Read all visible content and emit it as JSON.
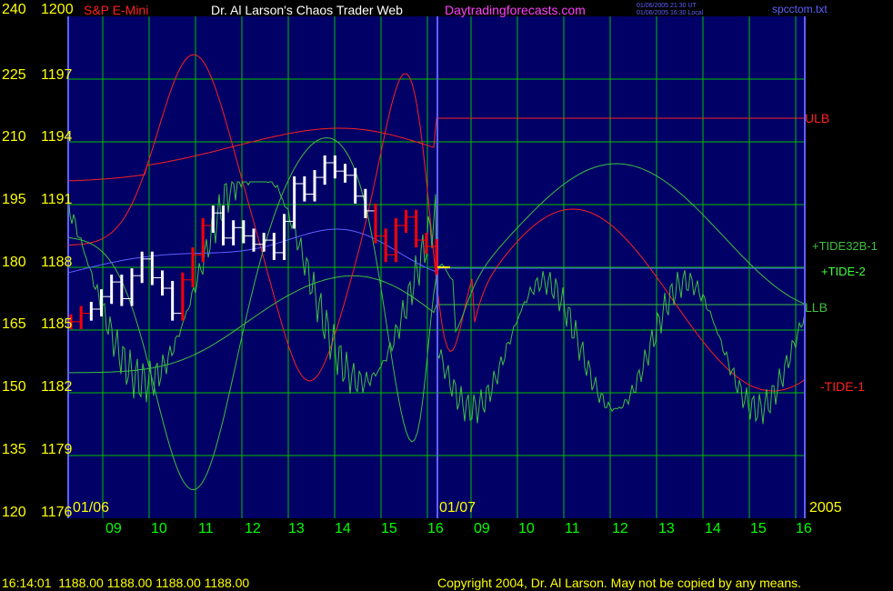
{
  "header": {
    "instrument": "S&P E-Mini",
    "site_title": "Dr. Al Larson's Chaos Trader Web",
    "site_url": "Daytradingforecasts.com",
    "ut_stamp": "01/06/2005 21:30 UT",
    "local_stamp": "01/06/2005 16:30 Local",
    "file_name": "spcctom.txt"
  },
  "footer": {
    "quote_line": "16:14:01  1188.00 1188.00 1188.00 1188.00",
    "copyright": "Copyright 2004, Dr. Al Larson. May not be copied by any means."
  },
  "date_labels": {
    "day1": "01/06",
    "day2": "01/07",
    "year": "2005"
  },
  "colors": {
    "background": "#000066",
    "grid": "#00c000",
    "yellow_text": "#ffff00",
    "red": "#ff2020",
    "green": "#40c040",
    "magenta": "#ff40ff",
    "blue_line": "#6060ff",
    "price_white": "#ffffff",
    "price_red": "#ff0000"
  },
  "chart_data": {
    "type": "line",
    "left_axis_ticks": [
      "240",
      "225",
      "210",
      "195",
      "180",
      "165",
      "150",
      "135",
      "120"
    ],
    "right_axis_ticks": [
      "1200",
      "1197",
      "1194",
      "1191",
      "1188",
      "1185",
      "1182",
      "1179",
      "1176"
    ],
    "left_axis_range": [
      120,
      240
    ],
    "price_axis_range": [
      1176,
      1200
    ],
    "x_ticks": [
      "09",
      "10",
      "11",
      "12",
      "13",
      "14",
      "15",
      "16",
      "09",
      "10",
      "11",
      "12",
      "13",
      "14",
      "15",
      "16"
    ],
    "series_labels": [
      "ULB",
      "+TIDE32B-1",
      "+TIDE-2",
      "LLB",
      "-TIDE-1"
    ],
    "last_price": 1188.0,
    "price_closes": [
      1185.4,
      1185.8,
      1186.0,
      1186.6,
      1187.3,
      1186.5,
      1187.6,
      1188.4,
      1187.5,
      1187.0,
      1185.8,
      1187.4,
      1188.6,
      1190.0,
      1190.6,
      1189.4,
      1189.9,
      1189.5,
      1189.1,
      1189.3,
      1188.7,
      1190.2,
      1192.0,
      1191.5,
      1192.3,
      1193.0,
      1192.6,
      1192.4,
      1191.4,
      1190.7,
      1189.5,
      1188.6,
      1190.0,
      1190.4,
      1189.3,
      1189.0,
      1188.0
    ]
  }
}
